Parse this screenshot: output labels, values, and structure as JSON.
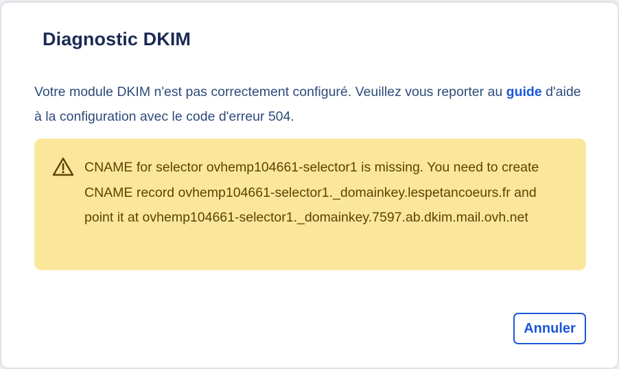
{
  "dialog": {
    "title": "Diagnostic DKIM",
    "message_before": "Votre module DKIM n'est pas correctement configuré. Veuillez vous reporter au ",
    "guide_link": "guide",
    "message_after": " d'aide à la configuration avec le code d'erreur 504.",
    "alert": {
      "icon": "warning-triangle-icon",
      "text": "CNAME for selector ovhemp104661-selector1 is missing. You need to create CNAME record ovhemp104661-selector1._domainkey.lespetancoeurs.fr and point it at ovhemp104661-selector1._domainkey.7597.ab.dkim.mail.ovh.net"
    },
    "cancel_label": "Annuler"
  },
  "colors": {
    "title": "#1a2a55",
    "text": "#2c4a7a",
    "link": "#1a56db",
    "alert_background": "#fbe79b",
    "alert_text": "#5a4400"
  }
}
